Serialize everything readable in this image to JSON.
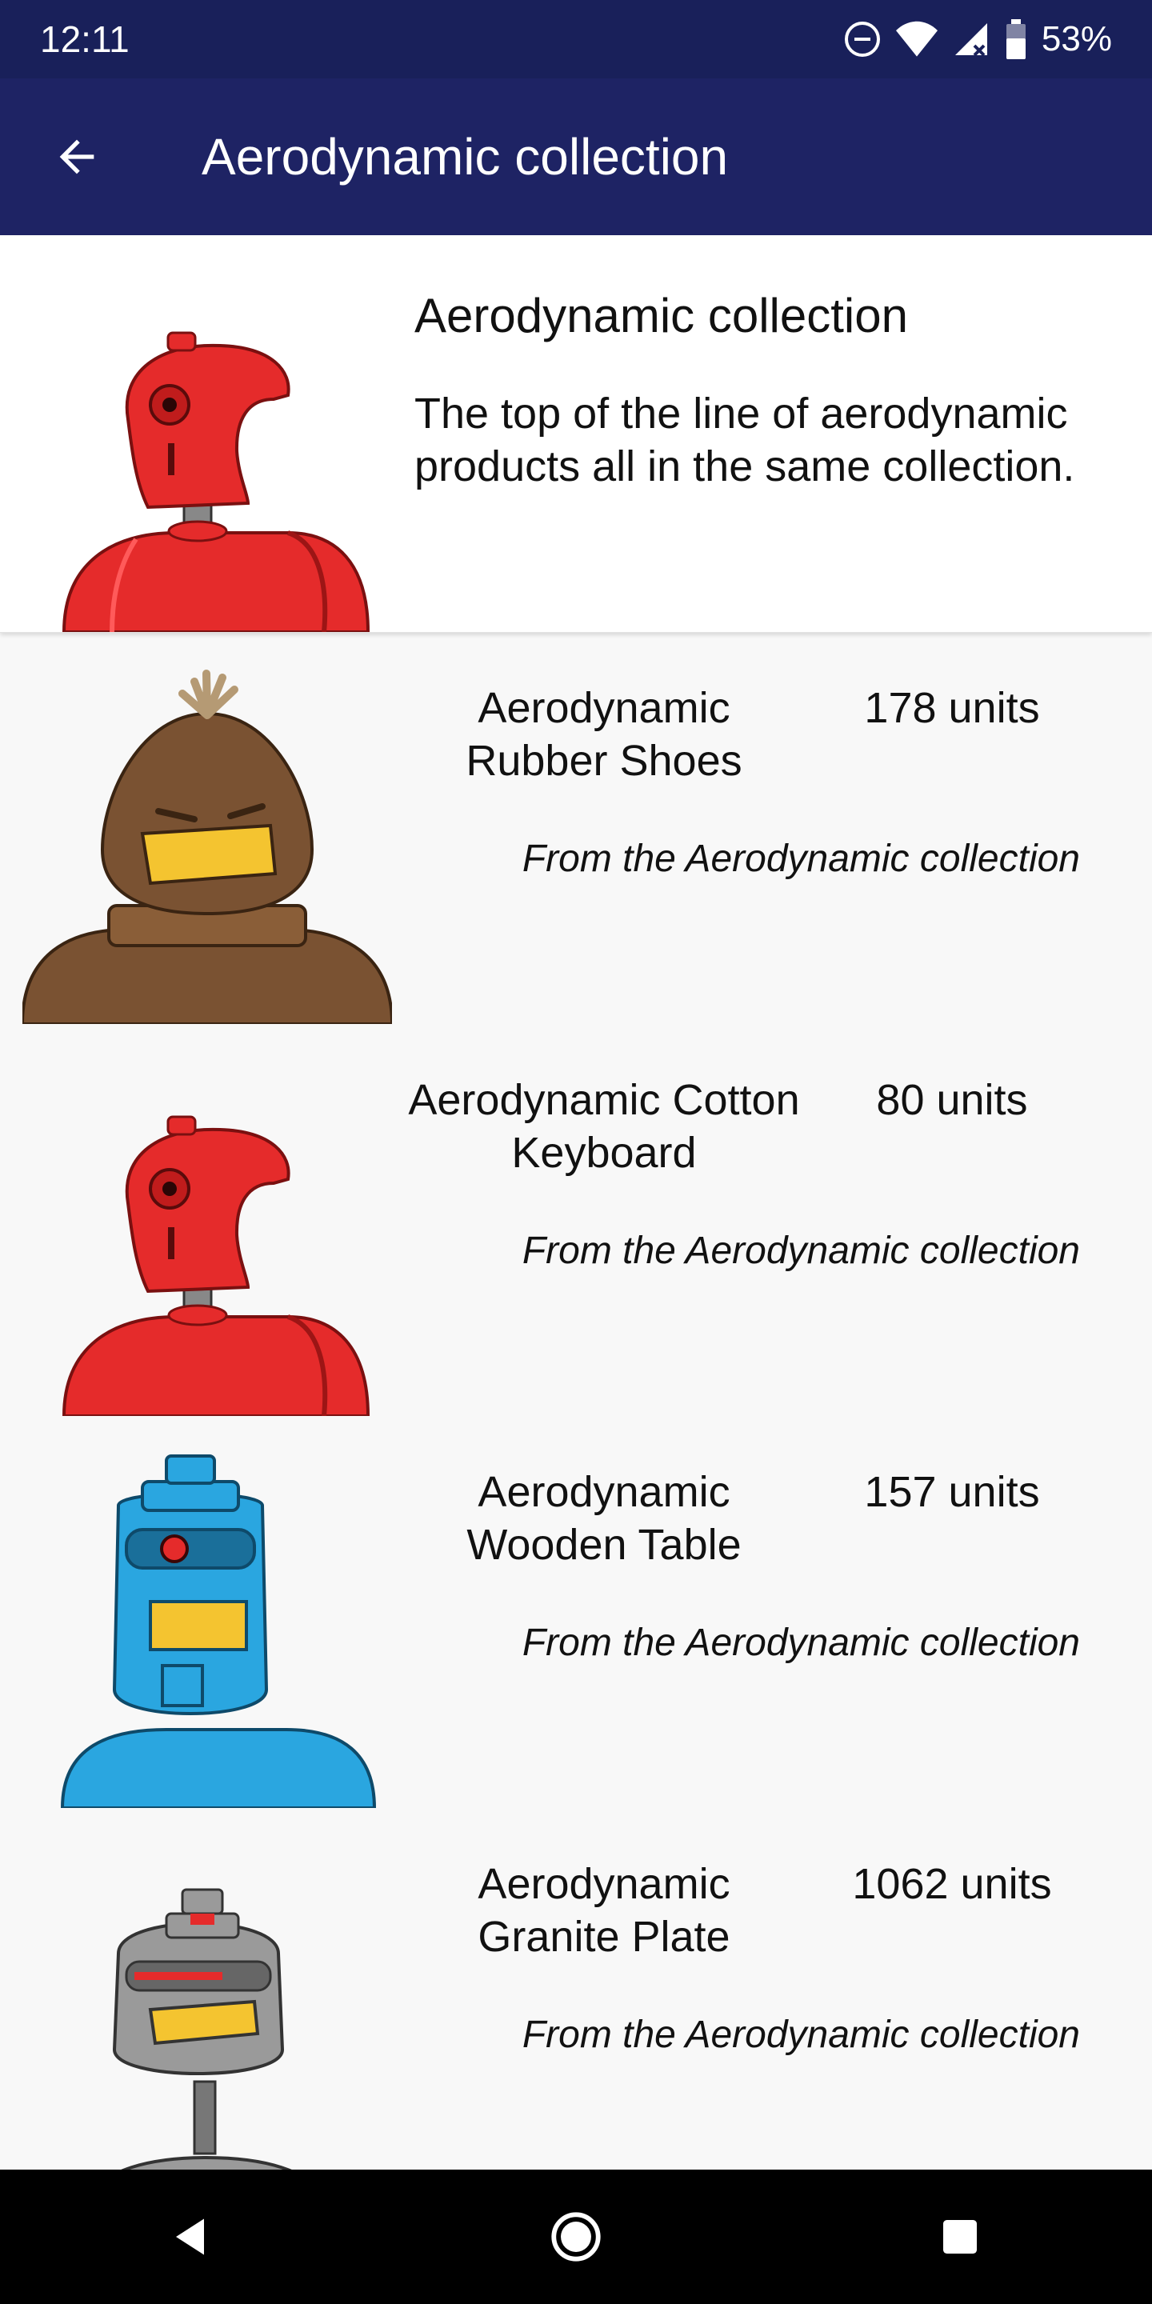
{
  "status_bar": {
    "time": "12:11",
    "battery": "53%"
  },
  "app_bar": {
    "title": "Aerodynamic collection"
  },
  "header": {
    "title": "Aerodynamic collection",
    "description": "The top of the line of aerodynamic products all in the same collection."
  },
  "products": [
    {
      "name": "Aerodynamic Rubber Shoes",
      "units": "178 units",
      "collection": "From the Aerodynamic collection",
      "color": "#7a5232"
    },
    {
      "name": "Aerodynamic Cotton Keyboard",
      "units": "80 units",
      "collection": "From the Aerodynamic collection",
      "color": "#e52b2b"
    },
    {
      "name": "Aerodynamic Wooden Table",
      "units": "157 units",
      "collection": "From the Aerodynamic collection",
      "color": "#2aa6e0"
    },
    {
      "name": "Aerodynamic Granite Plate",
      "units": "1062 units",
      "collection": "From the Aerodynamic collection",
      "color": "#9a9a9a"
    }
  ],
  "colors": {
    "status_bar": "#19205a",
    "app_bar": "#1e2364"
  }
}
